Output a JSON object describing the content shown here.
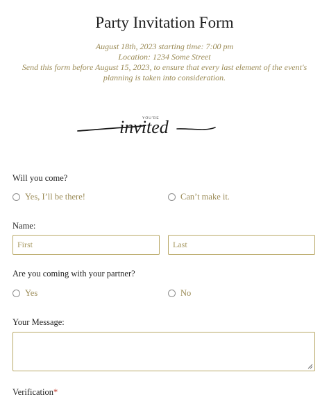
{
  "header": {
    "title": "Party Invitation Form",
    "date_line": "August 18th, 2023 starting time: 7:00 pm",
    "location_line": "Location: 1234 Some Street",
    "note_line_1": "Send this form before August 15, 2023, to ensure that every last element of the event's",
    "note_line_2": "planning is taken into consideration."
  },
  "banner": {
    "small_text": "YOU'RE",
    "script_text": "invited"
  },
  "questions": {
    "attend": {
      "label": "Will you come?",
      "options": [
        "Yes, I’ll be there!",
        "Can’t make it."
      ]
    },
    "name": {
      "label": "Name:",
      "first_placeholder": "First",
      "last_placeholder": "Last"
    },
    "partner": {
      "label": "Are you coming with your partner?",
      "options": [
        "Yes",
        "No"
      ]
    },
    "message": {
      "label": "Your Message:",
      "value": ""
    },
    "verification": {
      "label": "Verification",
      "required_mark": "*"
    }
  },
  "colors": {
    "accent": "#9a8a55",
    "field_border": "#b9a867",
    "required": "#c0392b"
  }
}
